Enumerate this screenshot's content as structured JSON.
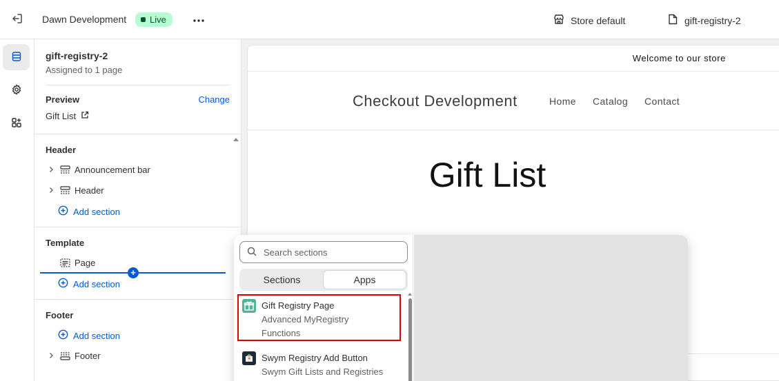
{
  "topbar": {
    "store_name": "Dawn Development",
    "status_badge": "Live",
    "store_default": "Store default",
    "page_selector": "gift-registry-2"
  },
  "sidebar": {
    "template_name": "gift-registry-2",
    "assigned": "Assigned to 1 page",
    "preview_label": "Preview",
    "change_link": "Change",
    "preview_page": "Gift List",
    "groups": {
      "header": {
        "title": "Header",
        "items": [
          "Announcement bar",
          "Header"
        ],
        "add_section": "Add section"
      },
      "template": {
        "title": "Template",
        "items": [
          "Page"
        ],
        "add_section": "Add section"
      },
      "footer": {
        "title": "Footer",
        "add_section": "Add section",
        "items": [
          "Footer"
        ]
      }
    }
  },
  "store_preview": {
    "announcement": "Welcome to our store",
    "brand": "Checkout Development",
    "nav": [
      "Home",
      "Catalog",
      "Contact"
    ],
    "page_title": "Gift List"
  },
  "section_picker": {
    "search_placeholder": "Search sections",
    "tabs": [
      "Sections",
      "Apps"
    ],
    "active_tab": "Apps",
    "apps": [
      {
        "name": "Gift Registry Page",
        "description": "Advanced MyRegistry Functions",
        "desc_line1": "Advanced MyRegistry",
        "desc_line2": "Functions",
        "icon": "gift-icon",
        "icon_color": "#4fb39a"
      },
      {
        "name": "Swym Registry Add Button",
        "description": "Swym Gift Lists and Registries",
        "icon": "swym-icon",
        "icon_color": "#1e2a3a"
      }
    ]
  },
  "colors": {
    "accent": "#005bd3",
    "live_badge_bg": "#b4fed2",
    "highlight": "#e00000"
  }
}
